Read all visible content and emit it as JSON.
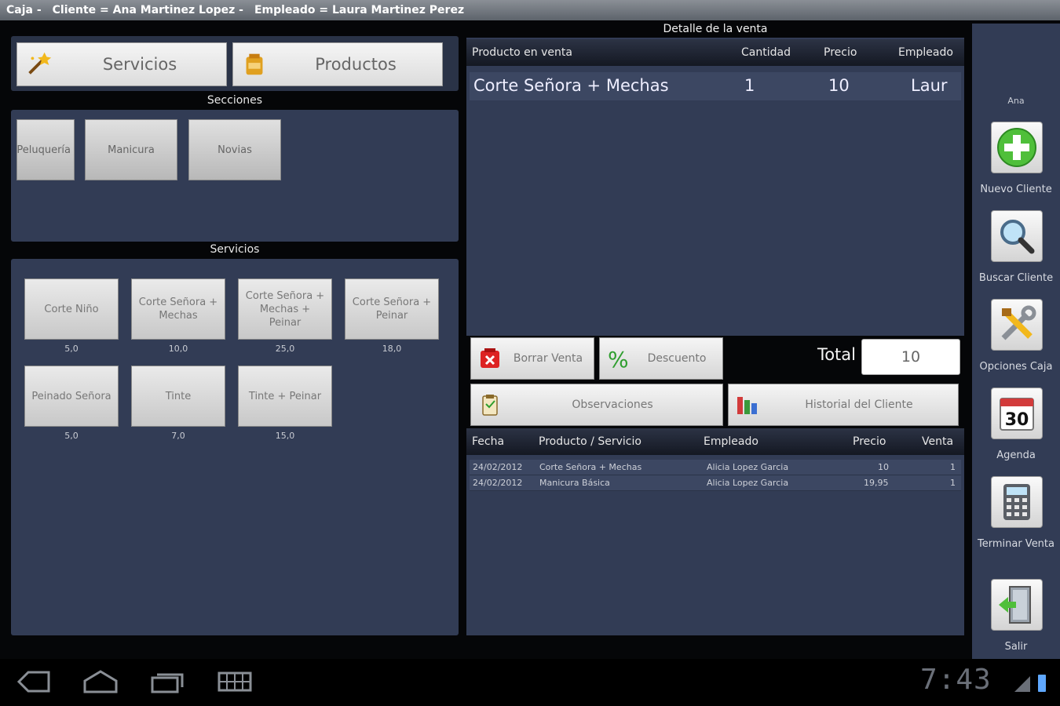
{
  "titlebar": {
    "app": "Caja -",
    "client": "Cliente = Ana Martinez Lopez -",
    "employee": "Empleado = Laura Martinez Perez"
  },
  "tabs": [
    {
      "label": "Servicios",
      "icon": "magic-wand-icon"
    },
    {
      "label": "Productos",
      "icon": "product-box-icon"
    }
  ],
  "sections": {
    "caption": "Secciones",
    "items": [
      "Peluquería",
      "Manicura",
      "Novias"
    ]
  },
  "services": {
    "caption": "Servicios",
    "items": [
      {
        "label": "Corte Niño",
        "price": "5,0"
      },
      {
        "label": "Corte Señora + Mechas",
        "price": "10,0"
      },
      {
        "label": "Corte Señora + Mechas + Peinar",
        "price": "25,0"
      },
      {
        "label": "Corte Señora + Peinar",
        "price": "18,0"
      },
      {
        "label": "Peinado Señora",
        "price": "5,0"
      },
      {
        "label": "Tinte",
        "price": "7,0"
      },
      {
        "label": "Tinte + Peinar",
        "price": "15,0"
      }
    ]
  },
  "detail": {
    "title": "Detalle de la venta",
    "columns": [
      "Producto en venta",
      "Cantidad",
      "Precio",
      "Empleado"
    ],
    "rows": [
      {
        "product": "Corte Señora + Mechas",
        "qty": "1",
        "price": "10",
        "employee": "Laur"
      }
    ]
  },
  "actions": {
    "delete_sale": "Borrar Venta",
    "discount": "Descuento",
    "observations": "Observaciones",
    "client_history": "Historial del Cliente"
  },
  "total": {
    "label": "Total",
    "value": "10"
  },
  "history": {
    "columns": [
      "Fecha",
      "Producto / Servicio",
      "Empleado",
      "Precio",
      "Venta"
    ],
    "rows": [
      {
        "date": "24/02/2012",
        "product": "Corte Señora + Mechas",
        "employee": "Alicia Lopez Garcia",
        "price": "10",
        "sale": "1"
      },
      {
        "date": "24/02/2012",
        "product": "Manicura Básica",
        "employee": "Alicia Lopez Garcia",
        "price": "19,95",
        "sale": "1"
      }
    ]
  },
  "sidebar": {
    "client_name": "Ana",
    "items": [
      {
        "label": "Nuevo Cliente",
        "icon": "add-icon"
      },
      {
        "label": "Buscar Cliente",
        "icon": "magnifier-icon"
      },
      {
        "label": "Opciones Caja",
        "icon": "tools-icon"
      },
      {
        "label": "Agenda",
        "icon": "calendar-icon",
        "day": "30"
      },
      {
        "label": "Terminar Venta",
        "icon": "calculator-icon"
      },
      {
        "label": "Salir",
        "icon": "exit-door-icon"
      }
    ]
  },
  "statusbar": {
    "time": "7:43"
  },
  "colors": {
    "panel": "#323c55",
    "accent_green": "#4fbf3a",
    "discount_green": "#2f9e2f"
  }
}
